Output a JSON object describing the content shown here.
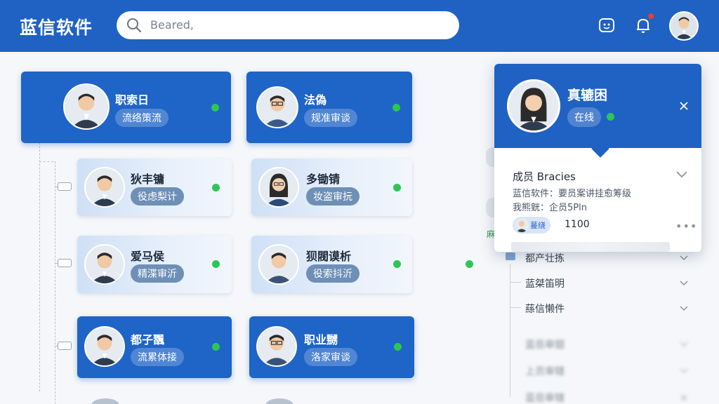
{
  "header": {
    "title": "蓝信软件",
    "search_text": "Beared,",
    "bell_badge": ""
  },
  "cards": [
    {
      "name": "职索日",
      "tag": "流络策流",
      "status": "online"
    },
    {
      "name": "法偽",
      "tag": "规准审谈",
      "status": "online"
    },
    {
      "name": "狄丰镛",
      "tag": "役虑梨计",
      "status": "online"
    },
    {
      "name": "多锄锖",
      "tag": "妆盗审抏",
      "status": "online"
    },
    {
      "name": "爱马侯",
      "tag": "精渫审沂",
      "status": "online"
    },
    {
      "name": "狈閥谟析",
      "tag": "役索抖沂",
      "status": "online"
    },
    {
      "name": "都子飁",
      "tag": "流累体接",
      "status": "online"
    },
    {
      "name": "职业嬲",
      "tag": "洛家审谈",
      "status": "online"
    }
  ],
  "popup": {
    "name": "真辘困",
    "status": "在线",
    "member_label": "成员 Bracies",
    "line1": "蓝信软件：要员案讲挂愈筹级",
    "line2": "我熊皝：企员5Pln",
    "chip_label": "蔓绕",
    "count": "1100",
    "more": "•••"
  },
  "right_list": [
    {
      "label": "都产壮拣",
      "blurred": false
    },
    {
      "label": "蓝桀笛明",
      "blurred": false
    },
    {
      "label": "蕬信懒件",
      "blurred": false
    },
    {
      "label": "蓝岳审翅",
      "blurred": true
    },
    {
      "label": "上员审辖",
      "blurred": true
    },
    {
      "label": "蓝岳审辖",
      "blurred": true
    }
  ],
  "side_text": "麻",
  "colors": {
    "header": "#1f62c3",
    "card_dark": "#1f64c7",
    "online": "#2dc653",
    "badge": "#ec3b3b"
  }
}
